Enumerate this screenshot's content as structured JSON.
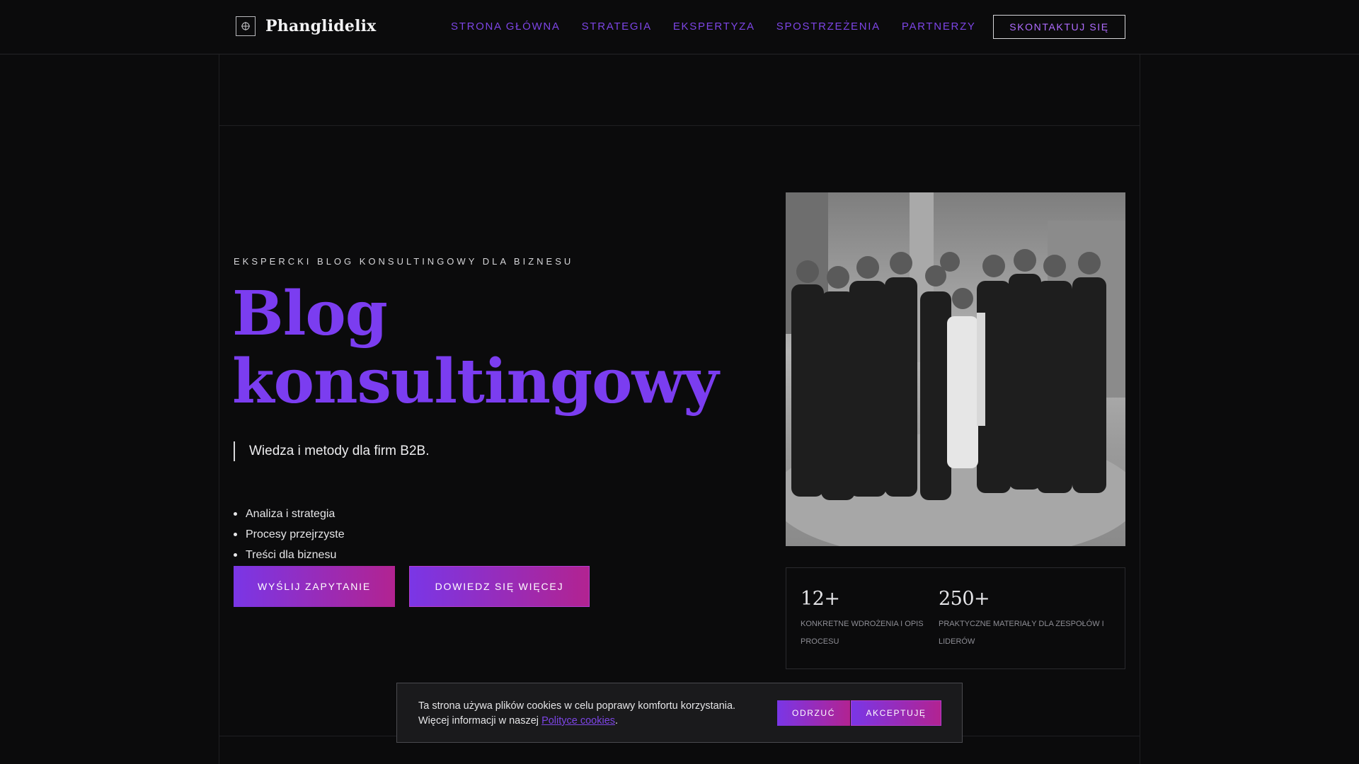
{
  "header": {
    "brand": "Phanglidelix",
    "brand_icon": "crosshair-icon",
    "nav": [
      {
        "label": "STRONA GŁÓWNA"
      },
      {
        "label": "STRATEGIA"
      },
      {
        "label": "EKSPERTYZA"
      },
      {
        "label": "SPOSTRZEŻENIA"
      },
      {
        "label": "PARTNERZY"
      }
    ],
    "cta": "SKONTAKTUJ SIĘ"
  },
  "hero": {
    "eyebrow": "EKSPERCKI BLOG KONSULTINGOWY DLA BIZNESU",
    "title_line1": "Blog",
    "title_line2": "konsultingowy",
    "lead": "Wiedza i metody dla firm B2B.",
    "bullets": [
      "Analiza i strategia",
      "Procesy przejrzyste",
      "Treści dla biznesu"
    ],
    "primary_button": "WYŚLIJ ZAPYTANIE",
    "secondary_button": "DOWIEDZ SIĘ WIĘCEJ"
  },
  "stats": [
    {
      "value": "12+",
      "label": "KONKRETNE WDROŻENIA I OPIS PROCESU"
    },
    {
      "value": "250+",
      "label": "PRAKTYCZNE MATERIAŁY DLA ZESPOŁÓW I LIDERÓW"
    }
  ],
  "cookie": {
    "line1": "Ta strona używa plików cookies w celu poprawy komfortu korzystania.",
    "line2_prefix": "Więcej informacji w naszej ",
    "link": "Polityce cookies",
    "line2_suffix": ".",
    "reject": "ODRZUĆ",
    "accept": "AKCEPTUJĘ"
  },
  "colors": {
    "background": "#0b0b0c",
    "accent": "#7b3df0",
    "accent_gradient_end": "#b22391",
    "text": "#e9e9ea"
  }
}
